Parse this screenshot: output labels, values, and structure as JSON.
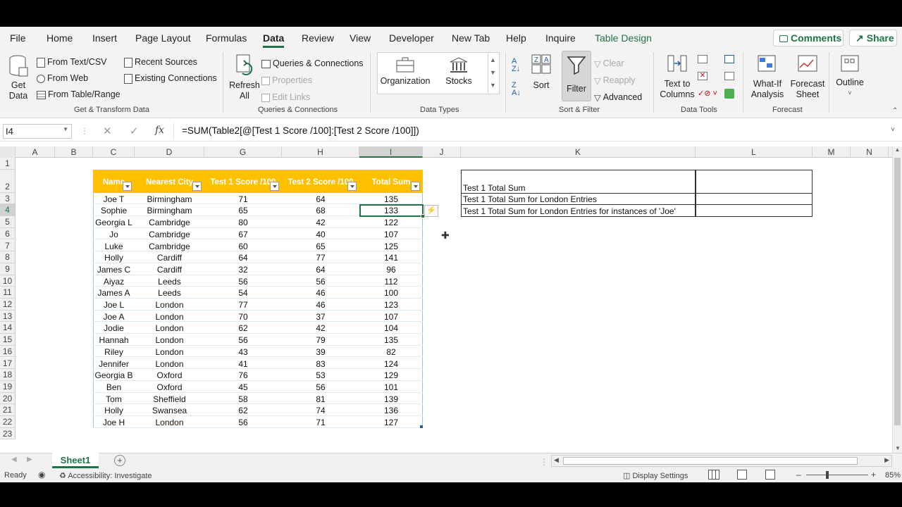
{
  "ribbon_tabs": [
    "File",
    "Home",
    "Insert",
    "Page Layout",
    "Formulas",
    "Data",
    "Review",
    "View",
    "Developer",
    "New Tab",
    "Help",
    "Inquire",
    "Table Design"
  ],
  "active_tab": "Data",
  "top_buttons": {
    "comments": "Comments",
    "share": "Share"
  },
  "ribbon": {
    "get_data": "Get\nData",
    "from_text_csv": "From Text/CSV",
    "from_web": "From Web",
    "from_table_range": "From Table/Range",
    "recent_sources": "Recent Sources",
    "existing_connections": "Existing Connections",
    "group_get_transform": "Get & Transform Data",
    "refresh_all": "Refresh\nAll",
    "queries_connections": "Queries & Connections",
    "properties": "Properties",
    "edit_links": "Edit Links",
    "group_queries": "Queries & Connections",
    "organization": "Organization",
    "stocks": "Stocks",
    "group_data_types": "Data Types",
    "sort": "Sort",
    "filter": "Filter",
    "clear": "Clear",
    "reapply": "Reapply",
    "advanced": "Advanced",
    "group_sort_filter": "Sort & Filter",
    "text_to_columns": "Text to\nColumns",
    "group_data_tools": "Data Tools",
    "what_if": "What-If\nAnalysis",
    "forecast_sheet": "Forecast\nSheet",
    "group_forecast": "Forecast",
    "outline": "Outline"
  },
  "formula_bar": {
    "name_box": "I4",
    "fx": "fx",
    "formula": "=SUM(Table2[@[Test 1 Score /100]:[Test 2 Score /100]])"
  },
  "columns": [
    "A",
    "B",
    "C",
    "D",
    "G",
    "H",
    "I",
    "J",
    "K",
    "L",
    "M",
    "N"
  ],
  "selected_column": "I",
  "rows": [
    "1",
    "2",
    "3",
    "4",
    "5",
    "6",
    "7",
    "8",
    "9",
    "10",
    "11",
    "12",
    "13",
    "14",
    "15",
    "16",
    "17",
    "18",
    "19",
    "20",
    "21",
    "22",
    "23"
  ],
  "selected_row": "4",
  "table": {
    "headers": [
      "Name",
      "Nearest City",
      "Test 1 Score /100",
      "Test 2 Score /100",
      "Total Sum"
    ],
    "header_color": "#FFC000",
    "rows": [
      [
        "Joe T",
        "Birmingham",
        "71",
        "64",
        "135"
      ],
      [
        "Sophie",
        "Birmingham",
        "65",
        "68",
        "133"
      ],
      [
        "Georgia L",
        "Cambridge",
        "80",
        "42",
        "122"
      ],
      [
        "Jo",
        "Cambridge",
        "67",
        "40",
        "107"
      ],
      [
        "Luke",
        "Cambridge",
        "60",
        "65",
        "125"
      ],
      [
        "Holly",
        "Cardiff",
        "64",
        "77",
        "141"
      ],
      [
        "James C",
        "Cardiff",
        "32",
        "64",
        "96"
      ],
      [
        "Aiyaz",
        "Leeds",
        "56",
        "56",
        "112"
      ],
      [
        "James A",
        "Leeds",
        "54",
        "46",
        "100"
      ],
      [
        "Joe L",
        "London",
        "77",
        "46",
        "123"
      ],
      [
        "Joe A",
        "London",
        "70",
        "37",
        "107"
      ],
      [
        "Jodie",
        "London",
        "62",
        "42",
        "104"
      ],
      [
        "Hannah",
        "London",
        "56",
        "79",
        "135"
      ],
      [
        "Riley",
        "London",
        "43",
        "39",
        "82"
      ],
      [
        "Jennifer",
        "London",
        "41",
        "83",
        "124"
      ],
      [
        "Georgia B",
        "Oxford",
        "76",
        "53",
        "129"
      ],
      [
        "Ben",
        "Oxford",
        "45",
        "56",
        "101"
      ],
      [
        "Tom",
        "Sheffield",
        "58",
        "81",
        "139"
      ],
      [
        "Holly",
        "Swansea",
        "62",
        "74",
        "136"
      ],
      [
        "Joe H",
        "London",
        "56",
        "71",
        "127"
      ]
    ]
  },
  "summary_labels": [
    "Test 1 Total Sum",
    "Test 1 Total Sum for London Entries",
    "Test 1 Total Sum for London Entries for instances of 'Joe'"
  ],
  "sheet_tab": "Sheet1",
  "status": {
    "ready": "Ready",
    "accessibility": "Accessibility: Investigate",
    "display_settings": "Display Settings",
    "zoom": "85%"
  },
  "accent_color": "#217346"
}
